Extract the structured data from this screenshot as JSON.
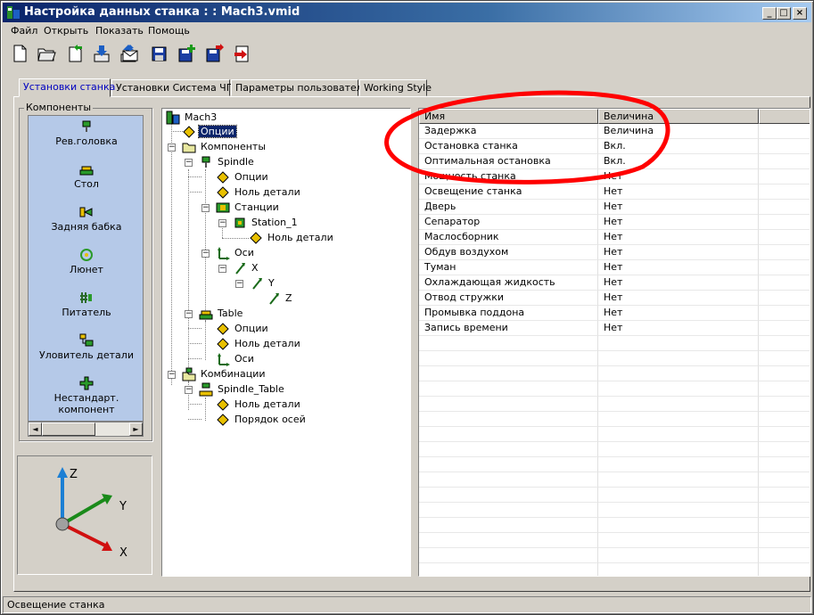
{
  "window": {
    "title": "Настройка данных станка : : Mach3.vmid"
  },
  "menu": [
    "Файл",
    "Открыть",
    "Показать",
    "Помощь"
  ],
  "toolbar": [
    "new-file-icon",
    "open-folder-icon",
    "import-icon",
    "download-icon",
    "upload-icon",
    "mail-icon",
    "save-icon",
    "save-add-icon",
    "save-as-icon",
    "exit-icon"
  ],
  "tabs": [
    "Установки станка",
    "Установки Система ЧПУ",
    "Параметры пользователя",
    "Working Style"
  ],
  "components": {
    "group_label": "Компоненты",
    "items": [
      "Рев.головка",
      "Стол",
      "Задняя бабка",
      "Люнет",
      "Питатель",
      "Уловитель детали",
      "Нестандарт. компонент"
    ]
  },
  "axes_labels": {
    "z": "Z",
    "y": "Y",
    "x": "X"
  },
  "tree": {
    "root": "Mach3",
    "opts": "Опции",
    "components": "Компоненты",
    "spindle": "Spindle",
    "spindle_opts": "Опции",
    "spindle_zero": "Ноль детали",
    "stations": "Станции",
    "station1": "Station_1",
    "station1_zero": "Ноль детали",
    "axes": "Оси",
    "x": "X",
    "y": "Y",
    "z": "Z",
    "table": "Table",
    "table_opts": "Опции",
    "table_zero": "Ноль детали",
    "table_axes": "Оси",
    "combos": "Комбинации",
    "spindle_table": "Spindle_Table",
    "st_zero": "Ноль детали",
    "st_order": "Порядок осей"
  },
  "grid": {
    "columns": [
      "Имя",
      "Величина"
    ],
    "rows": [
      [
        "Задержка",
        "Величина"
      ],
      [
        "Остановка станка",
        "Вкл."
      ],
      [
        "Оптимальная остановка",
        "Вкл."
      ],
      [
        "Мощность станка",
        "Нет"
      ],
      [
        "Освещение станка",
        "Нет"
      ],
      [
        "Дверь",
        "Нет"
      ],
      [
        "Сепаратор",
        "Нет"
      ],
      [
        "Маслосборник",
        "Нет"
      ],
      [
        "Обдув воздухом",
        "Нет"
      ],
      [
        "Туман",
        "Нет"
      ],
      [
        "Охлаждающая жидкость",
        "Нет"
      ],
      [
        "Отвод стружки",
        "Нет"
      ],
      [
        "Промывка поддона",
        "Нет"
      ],
      [
        "Запись времени",
        "Нет"
      ]
    ]
  },
  "status": "Освещение станка",
  "colors": {
    "title_start": "#0a246a",
    "selection": "#0a246a",
    "annotation": "#ff0000",
    "component_bg": "#b5c9e8"
  }
}
